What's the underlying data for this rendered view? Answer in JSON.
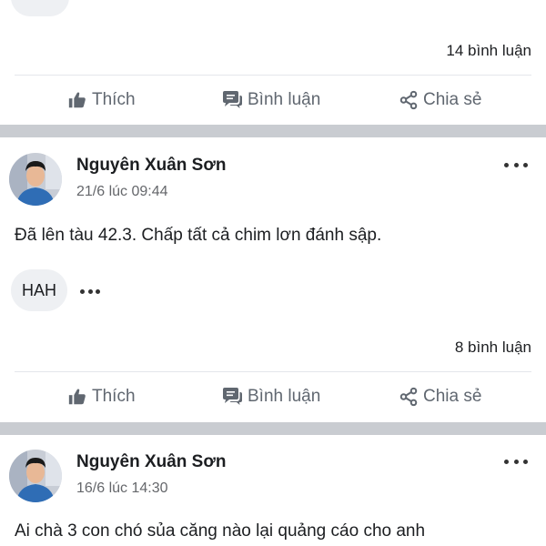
{
  "post_top": {
    "comments_count": "14 bình luận"
  },
  "actions_labels": {
    "like": "Thích",
    "comment": "Bình luận",
    "share": "Chia sẻ"
  },
  "post_1": {
    "author": "Nguyên Xuân Sơn",
    "time": "21/6 lúc 09:44",
    "text": "Đã lên tàu 42.3. Chấp tất cả chim lơn đánh sập.",
    "chip": "HAH",
    "comments_count": "8 bình luận"
  },
  "post_2": {
    "author": "Nguyên Xuân Sơn",
    "time": "16/6 lúc 14:30",
    "text": "Ai chà 3 con chó sủa căng nào lại quảng cáo cho anh"
  },
  "icons": {
    "like": "thumbs-up-icon",
    "comment": "comment-bubble-icon",
    "share": "share-icon",
    "more": "more-horizontal-icon"
  },
  "colors": {
    "separator": "#c9ccd1",
    "action_text": "#606770",
    "chip_bg": "#eef0f3"
  }
}
